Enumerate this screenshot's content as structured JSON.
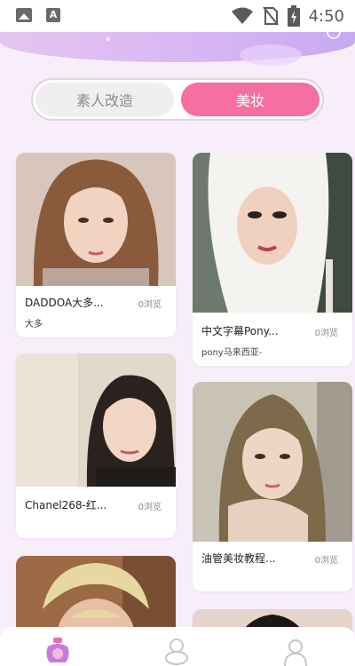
{
  "status_bar": {
    "time": "4:50",
    "icons": [
      "gallery-icon",
      "font-a-icon",
      "wifi-icon",
      "no-sim-icon",
      "battery-charging-icon"
    ]
  },
  "tabs": {
    "items": [
      {
        "label": "素人改造",
        "active": false
      },
      {
        "label": "美妆",
        "active": true
      }
    ]
  },
  "colors": {
    "accent": "#f56fa0",
    "header_gradient_start": "#e6c5f0",
    "header_gradient_end": "#c7a9f3",
    "background": "#f7eefa"
  },
  "feed": {
    "left": [
      {
        "title": "DADDOA大多...",
        "views": "0浏览",
        "subtitle": "大多"
      },
      {
        "title": "Chanel268-红...",
        "views": "0浏览",
        "subtitle": ""
      },
      {
        "title": "",
        "views": "",
        "subtitle": ""
      }
    ],
    "right": [
      {
        "title": "中文字幕Pony...",
        "views": "0浏览",
        "subtitle": "pony马来西亚-"
      },
      {
        "title": "油管美妆教程...",
        "views": "0浏览",
        "subtitle": ""
      },
      {
        "title": "",
        "views": "",
        "subtitle": ""
      }
    ]
  },
  "bottom_nav": {
    "items": [
      {
        "icon": "cosmetics-home-icon",
        "active": true
      },
      {
        "icon": "category-icon",
        "active": false
      },
      {
        "icon": "profile-icon",
        "active": false
      }
    ]
  }
}
